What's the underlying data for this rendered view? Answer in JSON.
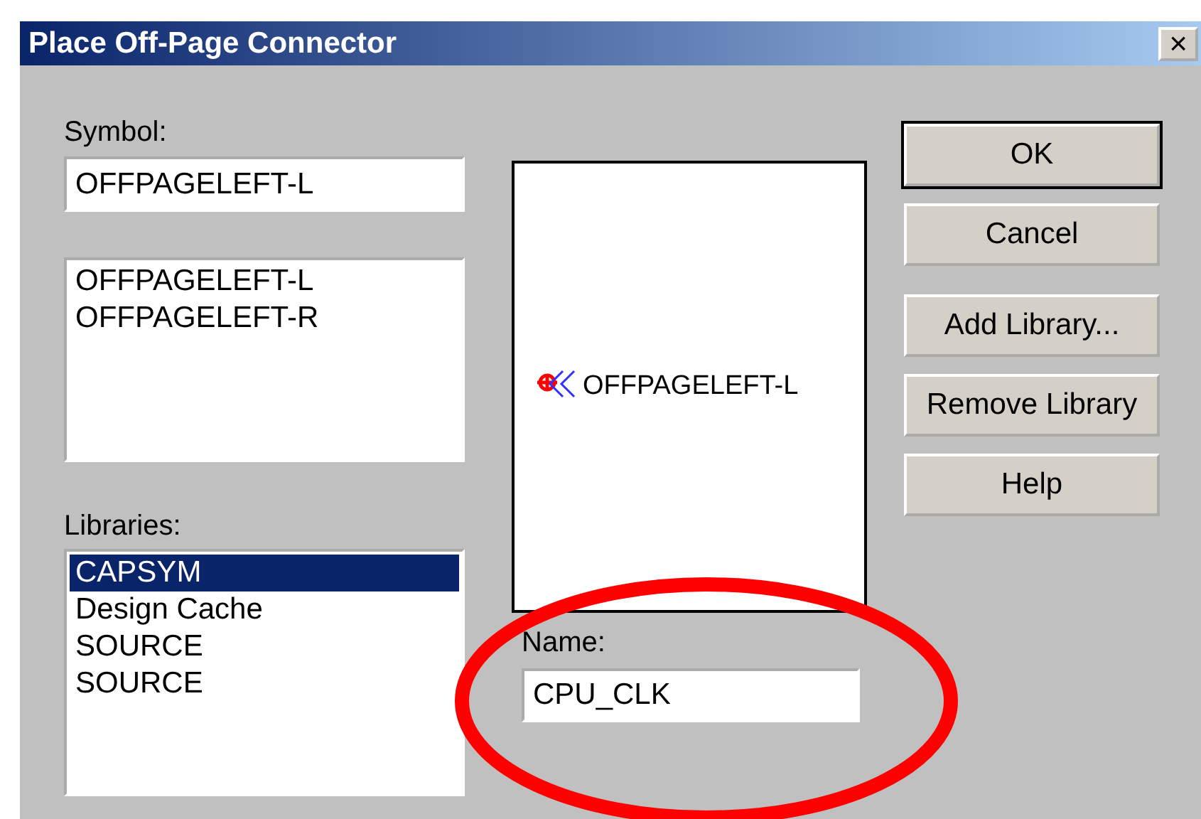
{
  "window": {
    "title": "Place Off-Page Connector",
    "close_button": "×"
  },
  "symbol": {
    "label": "Symbol:",
    "value": "OFFPAGELEFT-L"
  },
  "symbol_list": [
    {
      "label": "OFFPAGELEFT-L",
      "selected": false
    },
    {
      "label": "OFFPAGELEFT-R",
      "selected": false
    }
  ],
  "preview": {
    "label": "OFFPAGELEFT-L"
  },
  "libraries": {
    "label": "Libraries:",
    "items": [
      {
        "label": "CAPSYM",
        "selected": true
      },
      {
        "label": "Design Cache",
        "selected": false
      },
      {
        "label": "SOURCE",
        "selected": false
      },
      {
        "label": "SOURCE",
        "selected": false
      }
    ]
  },
  "name": {
    "label": "Name:",
    "value": "CPU_CLK"
  },
  "buttons": [
    {
      "label": "OK",
      "default": true
    },
    {
      "label": "Cancel",
      "default": false
    },
    {
      "label": "Add Library...",
      "default": false
    },
    {
      "label": "Remove Library",
      "default": false
    },
    {
      "label": "Help",
      "default": false
    }
  ]
}
